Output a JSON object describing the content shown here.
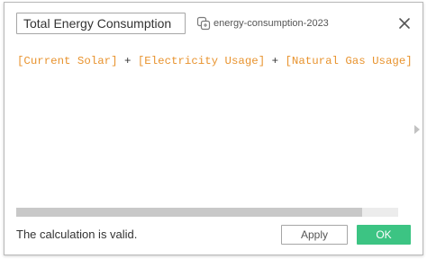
{
  "calc": {
    "name": "Total Energy Consumption",
    "datasource": "energy-consumption-2023",
    "datasource_icon": "datasource-icon",
    "close_icon": "close-icon"
  },
  "formula": {
    "field_1": "[Current Solar]",
    "op_1": " + ",
    "field_2": "[Electricity Usage]",
    "op_2": " + ",
    "field_3": "[Natural Gas Usage]"
  },
  "status": {
    "message": "The calculation is valid."
  },
  "buttons": {
    "apply": "Apply",
    "ok": "OK"
  },
  "colors": {
    "field": "#e8932e",
    "ok_bg": "#3cc483"
  }
}
